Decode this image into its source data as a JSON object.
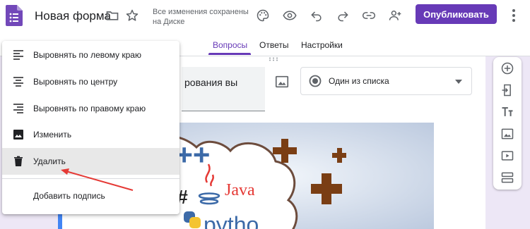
{
  "header": {
    "title": "Новая форма",
    "save_status": "Все изменения сохранены на Диске",
    "publish_label": "Опубликовать",
    "icons": [
      "folder-icon",
      "star-icon",
      "palette-icon",
      "eye-icon",
      "undo-icon",
      "redo-icon",
      "link-icon",
      "add-collaborator-icon",
      "more-icon"
    ]
  },
  "tabs": [
    {
      "label": "Вопросы",
      "active": true
    },
    {
      "label": "Ответы",
      "active": false
    },
    {
      "label": "Настройки",
      "active": false
    }
  ],
  "question": {
    "title_fragment": "рования вы",
    "type_label": "Один из списка"
  },
  "context_menu": {
    "items": [
      {
        "label": "Выровнять по левому краю",
        "icon": "align-left-icon"
      },
      {
        "label": "Выровнять по центру",
        "icon": "align-center-icon"
      },
      {
        "label": "Выровнять по правому краю",
        "icon": "align-right-icon"
      },
      {
        "label": "Изменить",
        "icon": "image-icon"
      },
      {
        "label": "Удалить",
        "icon": "trash-icon",
        "highlighted": true
      }
    ],
    "caption_label": "Добавить подпись"
  },
  "side_toolbar": [
    "add-question-icon",
    "import-icon",
    "title-text-icon",
    "add-image-icon",
    "add-video-icon",
    "add-section-icon"
  ],
  "image_text": {
    "cpp": "C++",
    "csharp": "C#",
    "java": "Java",
    "python": "pytho"
  },
  "colors": {
    "accent": "#673ab7",
    "background": "#ede7f6",
    "arrow": "#e53935"
  }
}
